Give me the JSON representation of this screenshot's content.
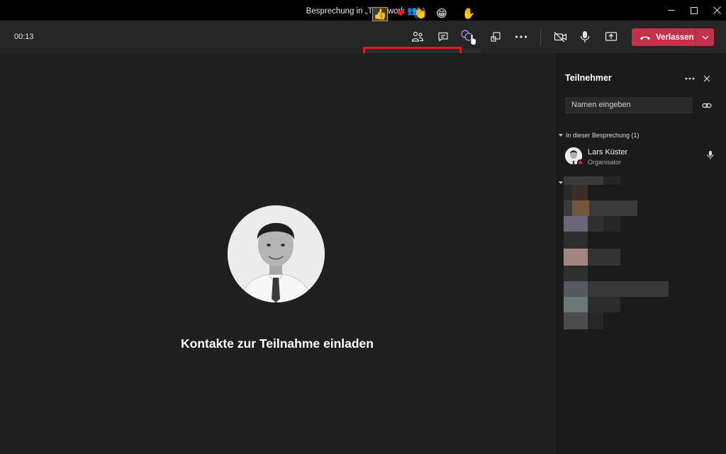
{
  "window": {
    "title": "Besprechung in „Teamwork 👥“"
  },
  "toolbar": {
    "timer": "00:13",
    "leave_label": "Verlassen",
    "accent_leave": "#c4314b"
  },
  "reactions": {
    "items": [
      {
        "name": "like",
        "glyph": "👍"
      },
      {
        "name": "heart",
        "glyph": "❤"
      },
      {
        "name": "applause",
        "glyph": "👏"
      },
      {
        "name": "laugh",
        "glyph": "😁"
      }
    ],
    "raise_hand_glyph": "✋",
    "highlight_color": "#e01b1b"
  },
  "stage": {
    "invite_text": "Kontakte zur Teilnahme einladen"
  },
  "panel": {
    "title": "Teilnehmer",
    "search_placeholder": "Namen eingeben",
    "section_label": "In dieser Besprechung (1)",
    "participants": [
      {
        "name": "Lars Küster",
        "role": "Organisator"
      }
    ]
  }
}
